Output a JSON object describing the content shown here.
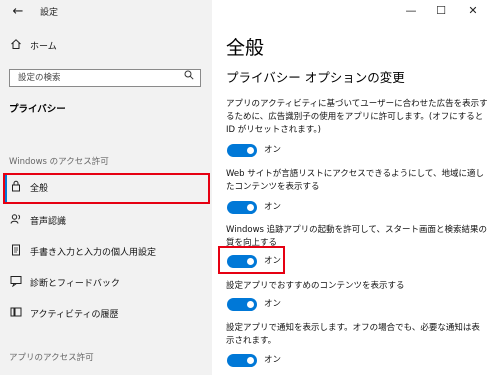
{
  "window": {
    "title": "設定",
    "controls": {
      "minimize": "—",
      "maximize": "☐",
      "close": "✕"
    }
  },
  "sidebar": {
    "home_label": "ホーム",
    "search_placeholder": "設定の検索",
    "privacy_heading": "プライバシー",
    "windows_permissions_heading": "Windows のアクセス許可",
    "items": [
      {
        "label": "全般",
        "icon": "lock-icon",
        "selected": true
      },
      {
        "label": "音声認識",
        "icon": "speech-icon",
        "selected": false
      },
      {
        "label": "手書き入力と入力の個人用設定",
        "icon": "pen-icon",
        "selected": false
      },
      {
        "label": "診断とフィードバック",
        "icon": "feedback-icon",
        "selected": false
      },
      {
        "label": "アクティビティの履歴",
        "icon": "history-icon",
        "selected": false
      }
    ],
    "app_permissions_heading": "アプリのアクセス許可"
  },
  "main": {
    "title": "全般",
    "subtitle": "プライバシー オプションの変更",
    "options": [
      {
        "description": "アプリのアクティビティに基づいてユーザーに合わせた広告を表示するために、広告識別子の使用をアプリに許可します。(オフにすると ID がリセットされます。)",
        "state_label": "オン",
        "on": true
      },
      {
        "description": "Web サイトが言語リストにアクセスできるようにして、地域に適したコンテンツを表示する",
        "state_label": "オン",
        "on": true
      },
      {
        "description": "Windows 追跡アプリの起動を許可して、スタート画面と検索結果の質を向上する",
        "state_label": "オン",
        "on": true
      },
      {
        "description": "設定アプリでおすすめのコンテンツを表示する",
        "state_label": "オン",
        "on": true
      },
      {
        "description": "設定アプリで通知を表示します。オフの場合でも、必要な通知は表示されます。",
        "state_label": "オン",
        "on": true
      }
    ]
  },
  "colors": {
    "accent": "#0078d7",
    "highlight": "#e60012",
    "sidebar_bg": "#f2f2f2"
  }
}
